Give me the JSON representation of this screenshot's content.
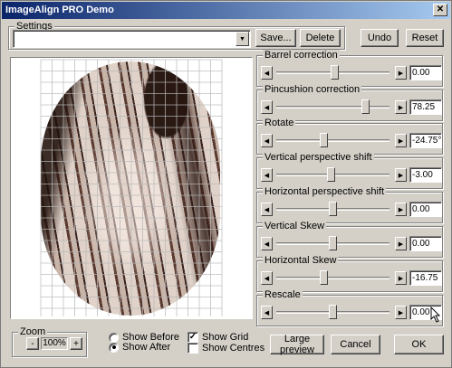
{
  "window": {
    "title": "ImageAlign PRO Demo",
    "close_glyph": "✕"
  },
  "settings": {
    "group_label": "Settings",
    "combo_value": "",
    "save_label": "Save...",
    "delete_label": "Delete",
    "undo_label": "Undo",
    "reset_label": "Reset"
  },
  "sliders": [
    {
      "label": "Barrel correction",
      "value": "0.00",
      "position": 0.52
    },
    {
      "label": "Pincushion correction",
      "value": "78.25",
      "position": 0.81
    },
    {
      "label": "Rotate",
      "value": "-24.75°",
      "position": 0.41
    },
    {
      "label": "Vertical perspective shift",
      "value": "-3.00",
      "position": 0.48
    },
    {
      "label": "Horizontal perspective shift",
      "value": "0.00",
      "position": 0.5
    },
    {
      "label": "Vertical Skew",
      "value": "0.00",
      "position": 0.5
    },
    {
      "label": "Horizontal Skew",
      "value": "-16.75",
      "position": 0.41
    },
    {
      "label": "Rescale",
      "value": "0.00",
      "position": 0.5
    }
  ],
  "slider_glyphs": {
    "left": "◀",
    "right": "▶"
  },
  "zoom": {
    "label": "Zoom",
    "minus": "-",
    "value": "100%",
    "plus": "+"
  },
  "view_options": {
    "show_before": "Show Before",
    "show_after": "Show After",
    "selected": "show_after",
    "show_grid": "Show Grid",
    "show_grid_checked": true,
    "show_centres": "Show Centres",
    "show_centres_checked": false,
    "check_glyph": "✓"
  },
  "buttons": {
    "large_preview": "Large preview",
    "cancel": "Cancel",
    "ok": "OK"
  },
  "icons": {
    "combo_arrow": "▼"
  }
}
